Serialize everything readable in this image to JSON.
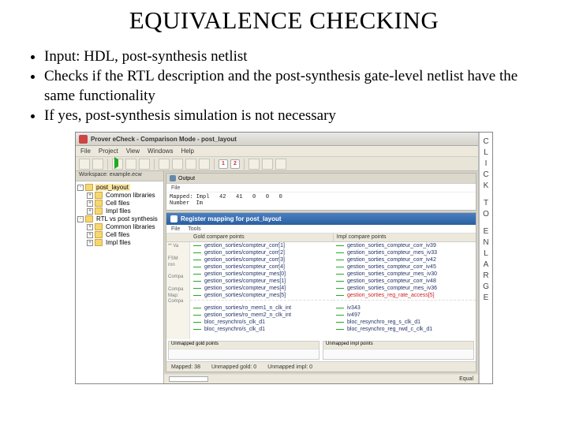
{
  "slide": {
    "title": "EQUIVALENCE CHECKING",
    "bullets": [
      "Input: HDL, post-synthesis netlist",
      "Checks if the RTL description and the post-synthesis gate-level netlist have the same functionality",
      "If yes, post-synthesis simulation is not necessary"
    ]
  },
  "sidelabel": [
    "C",
    "L",
    "I",
    "C",
    "K",
    "",
    "T",
    "O",
    "",
    "E",
    "N",
    "L",
    "A",
    "R",
    "G",
    "E"
  ],
  "app": {
    "titlebar": "Prover eCheck - Comparison Mode - post_layout",
    "menus": [
      "File",
      "Project",
      "View",
      "Windows",
      "Help"
    ],
    "workspace": {
      "header": "Workspace: example.ecw",
      "root": "post_layout",
      "group1": [
        "Common libraries",
        "Cell files",
        "Impl files"
      ],
      "group2_title": "RTL vs post synthesis",
      "group2": [
        "Common libraries",
        "Cell files",
        "Impl files"
      ]
    },
    "output": {
      "title": "Output",
      "menu": "File",
      "lines": [
        "Mapped: Impl   42   41   0   0   0",
        "Number  Im"
      ]
    },
    "register": {
      "title": "Register mapping for post_layout",
      "menus": [
        "File",
        "Tools"
      ],
      "col_gold": "Gold compare points",
      "col_impl": "Impl compare points",
      "gutter": [
        "** Va",
        "",
        "FSM",
        "ron",
        "",
        "Compa",
        "",
        "Compa",
        "Map:",
        "Compa"
      ],
      "gold_rows": [
        "gestion_sorties/compteur_corr[1]",
        "gestion_sorties/compteur_corr[2]",
        "gestion_sorties/compteur_corr[3]",
        "gestion_sorties/compteur_corr[4]",
        "gestion_sorties/compteur_mes[0]",
        "gestion_sorties/compteur_mes[1]",
        "gestion_sorties/compteur_mes[4]",
        "gestion_sorties/compteur_mes[5]"
      ],
      "impl_rows": [
        "gestion_sorties_compteur_corr_iv39",
        "gestion_sorties_compteur_mes_iv33",
        "gestion_sorties_compteur_corr_iv42",
        "gestion_sorties_compteur_corr_iv45",
        "gestion_sorties_compteur_mes_iv30",
        "gestion_sorties_compteur_corr_iv48",
        "gestion_sorties_compteur_mes_iv36",
        "gestion_sorties_reg_rate_access[5]"
      ],
      "bottom_gold": [
        "gestion_sorties/ro_mem1_n_clk_int",
        "gestion_sorties/ro_mem2_n_clk_int",
        "bloc_resynchro/s_clk_d1",
        "bloc_resynchro/s_clk_d1"
      ],
      "bottom_impl": [
        "iv343",
        "iv497",
        "bloc_resynchro_reg_s_clk_d1",
        "bloc_resynchro_reg_rwd_c_clk_d1"
      ],
      "unmapped_gold": "Unmapped gold points",
      "unmapped_impl": "Unmapped impl points"
    },
    "status1": {
      "mapped": "Mapped: 38",
      "ugold": "Unmapped gold: 0",
      "uimpl": "Unmapped impl: 0"
    },
    "status2": {
      "equal": "Equal"
    }
  }
}
